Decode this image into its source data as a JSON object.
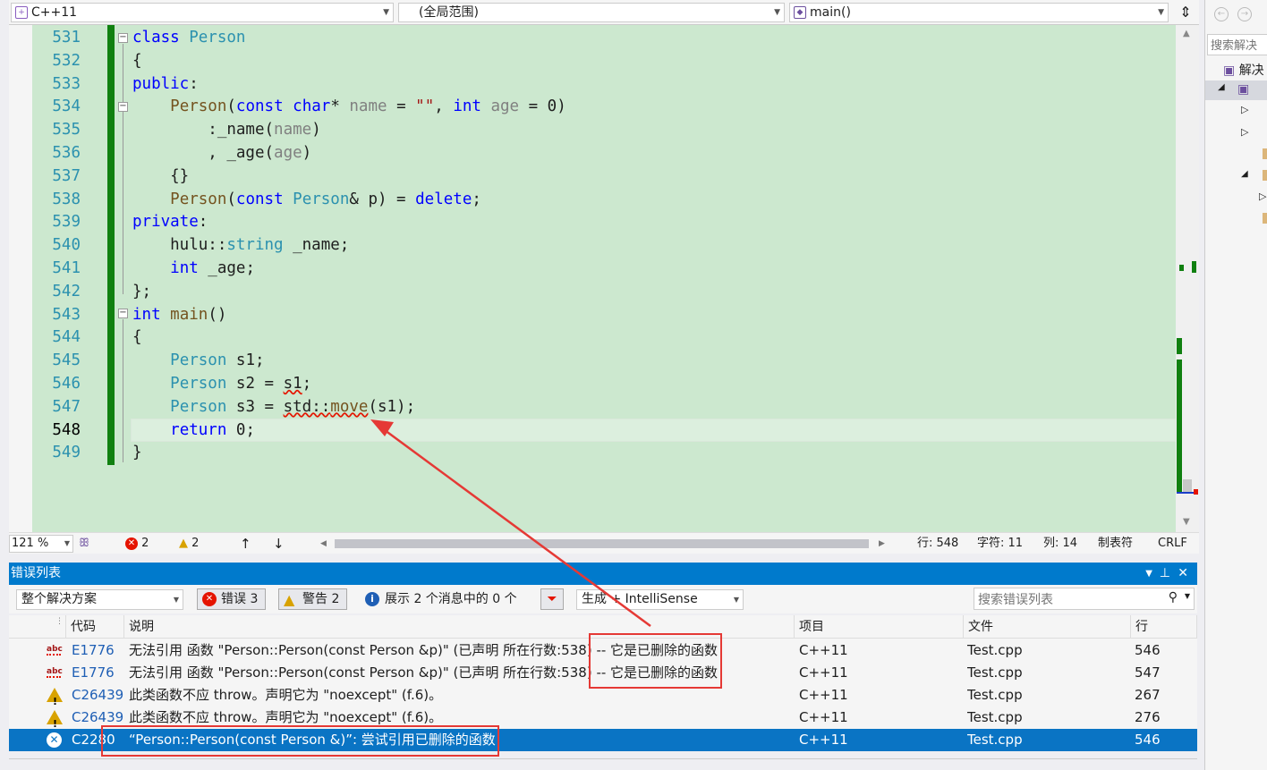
{
  "nav": {
    "project": "C++11",
    "scope": "(全局范围)",
    "member": "main()"
  },
  "code_lines": [
    {
      "n": "531",
      "html": "<span class='kw'>class</span> <span class='ty'>Person</span>"
    },
    {
      "n": "532",
      "html": "{"
    },
    {
      "n": "533",
      "html": "<span class='kw'>public</span>:"
    },
    {
      "n": "534",
      "html": "    <span class='fn'>Person</span>(<span class='kw'>const</span> <span class='kw'>char</span>* <span class='pm'>name</span> = <span class='st'>\"\"</span>, <span class='kw'>int</span> <span class='pm'>age</span> = 0)"
    },
    {
      "n": "535",
      "html": "        :_name(<span class='pm'>name</span>)"
    },
    {
      "n": "536",
      "html": "        , _age(<span class='pm'>age</span>)"
    },
    {
      "n": "537",
      "html": "    {}"
    },
    {
      "n": "538",
      "html": "    <span class='fn'>Person</span>(<span class='kw'>const</span> <span class='ty'>Person</span>&amp; p) = <span class='kw'>delete</span>;"
    },
    {
      "n": "539",
      "html": "<span class='kw'>private</span>:"
    },
    {
      "n": "540",
      "html": "    hulu::<span class='ty'>string</span> _name;"
    },
    {
      "n": "541",
      "html": "    <span class='kw'>int</span> _age;"
    },
    {
      "n": "542",
      "html": "};"
    },
    {
      "n": "543",
      "html": "<span class='kw'>int</span> <span class='fn'>main</span>()"
    },
    {
      "n": "544",
      "html": "{"
    },
    {
      "n": "545",
      "html": "    <span class='ty'>Person</span> s1;"
    },
    {
      "n": "546",
      "html": "    <span class='ty'>Person</span> s2 = <span class='sq'>s1</span>;"
    },
    {
      "n": "547",
      "html": "    <span class='ty'>Person</span> s3 = <span class='sq'>std::<span class='fn'>move</span></span>(s1);"
    },
    {
      "n": "548",
      "html": "    <span class='kw'>return</span> 0;"
    },
    {
      "n": "549",
      "html": "}"
    }
  ],
  "editor_status": {
    "zoom": "121 %",
    "errors": "2",
    "warnings": "2",
    "line": "行: 548",
    "char": "字符: 11",
    "col": "列: 14",
    "tabs": "制表符",
    "eol": "CRLF"
  },
  "error_list": {
    "title": "错误列表",
    "scope": "整个解决方案",
    "errors_btn": "错误 3",
    "warnings_btn": "警告 2",
    "messages_btn": "展示 2 个消息中的 0 个",
    "build_filter": "生成 + IntelliSense",
    "search_placeholder": "搜索错误列表",
    "columns": {
      "code": "代码",
      "desc": "说明",
      "project": "项目",
      "file": "文件",
      "line": "行"
    },
    "rows": [
      {
        "icon": "abc",
        "code": "E1776",
        "desc": "无法引用 函数 \"Person::Person(const Person &p)\" (已声明 所在行数:538) -- 它是已删除的函数",
        "project": "C++11",
        "file": "Test.cpp",
        "line": "546"
      },
      {
        "icon": "abc",
        "code": "E1776",
        "desc": "无法引用 函数 \"Person::Person(const Person &p)\" (已声明 所在行数:538) -- 它是已删除的函数",
        "project": "C++11",
        "file": "Test.cpp",
        "line": "547"
      },
      {
        "icon": "warn",
        "code": "C26439",
        "desc": "此类函数不应 throw。声明它为 \"noexcept\" (f.6)。",
        "project": "C++11",
        "file": "Test.cpp",
        "line": "267"
      },
      {
        "icon": "warn",
        "code": "C26439",
        "desc": "此类函数不应 throw。声明它为 \"noexcept\" (f.6)。",
        "project": "C++11",
        "file": "Test.cpp",
        "line": "276"
      },
      {
        "icon": "err",
        "code": "C2280",
        "desc": "“Person::Person(const Person &)”: 尝试引用已删除的函数",
        "project": "C++11",
        "file": "Test.cpp",
        "line": "546"
      }
    ]
  },
  "solution": {
    "search_placeholder": "搜索解决",
    "item": "解决"
  },
  "colors": {
    "accent": "#007acc",
    "selection": "#0a74c4",
    "annotation": "#e53935",
    "editor_bg": "#cce8cf"
  }
}
